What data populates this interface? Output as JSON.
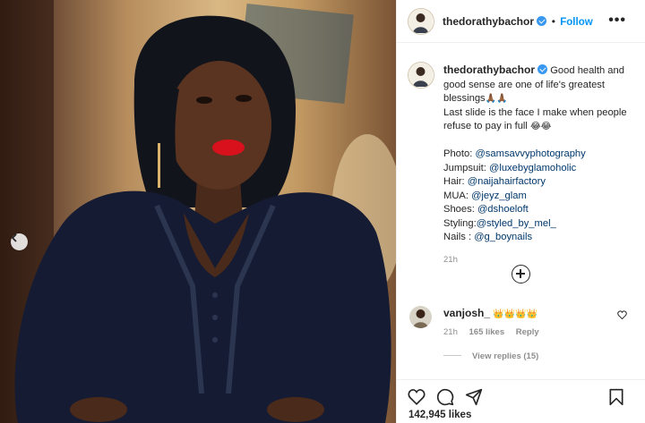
{
  "post": {
    "username": "thedorathybachor",
    "follow_label": "Follow",
    "header_separator": "•",
    "more_label": "•••"
  },
  "caption": {
    "text_1": "Good health and",
    "text_2": "good sense are one of life's greatest",
    "text_3": "blessings",
    "text_3_emoji": "🙏🏾🙏🏾",
    "text_4": "Last slide is the face I make when people",
    "text_5": "refuse to pay in full",
    "text_5_emoji": "😂😂",
    "credits": [
      {
        "label": "Photo: ",
        "handle": "@samsavvyphotography"
      },
      {
        "label": "Jumpsuit: ",
        "handle": "@luxebyglamoholic"
      },
      {
        "label": "Hair: ",
        "handle": "@naijahairfactory"
      },
      {
        "label": "MUA: ",
        "handle": "@jeyz_glam"
      },
      {
        "label": "Shoes: ",
        "handle": "@dshoeloft"
      },
      {
        "label": "Styling:",
        "handle": "@styled_by_mel_"
      },
      {
        "label": "Nails : ",
        "handle": "@g_boynails"
      }
    ],
    "time": "21h"
  },
  "comment": {
    "username": "vanjosh_",
    "emoji": "👑👑👑👑",
    "time": "21h",
    "likes": "165 likes",
    "reply_label": "Reply",
    "view_replies": "View replies (15)"
  },
  "likes_count": "142,945 likes",
  "icons": [
    "heart-icon",
    "comment-icon",
    "share-icon",
    "bookmark-icon",
    "add-comment-icon",
    "chevron-left-icon",
    "verified-badge-icon"
  ],
  "colors": {
    "link": "#00376b",
    "follow": "#0095f6",
    "verified": "#3897f0",
    "muted": "#8e8e8e"
  }
}
